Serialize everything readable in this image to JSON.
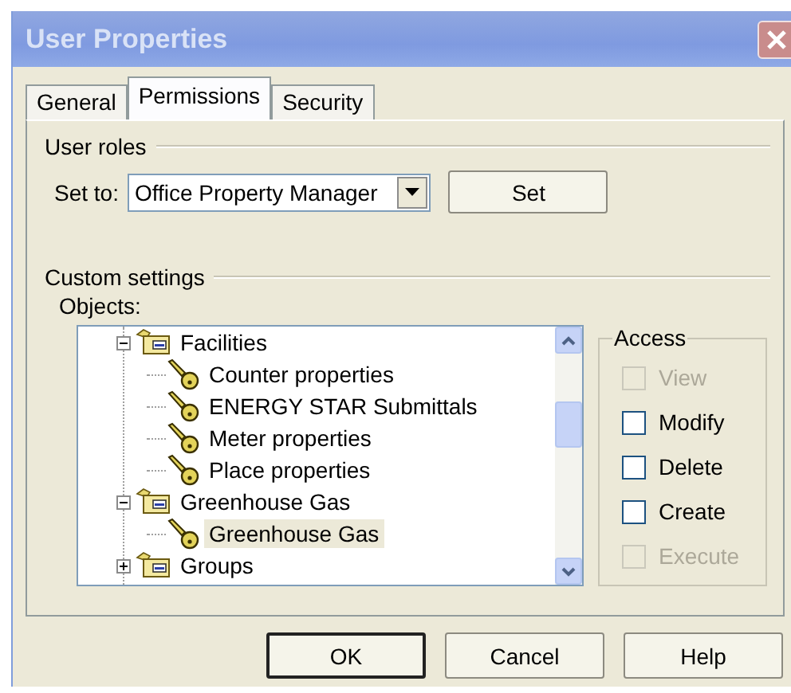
{
  "window": {
    "title": "User Properties"
  },
  "tabs": [
    {
      "label": "General",
      "selected": false
    },
    {
      "label": "Permissions",
      "selected": true
    },
    {
      "label": "Security",
      "selected": false
    }
  ],
  "user_roles": {
    "title": "User roles",
    "set_to_label": "Set to:",
    "role_value": "Office Property Manager",
    "set_button": "Set"
  },
  "custom_settings": {
    "title": "Custom settings",
    "objects_label": "Objects:",
    "tree": [
      {
        "label": "Facilities",
        "kind": "folder",
        "expanded": true,
        "selected": false,
        "children": [
          {
            "label": "Counter properties",
            "kind": "key",
            "selected": false
          },
          {
            "label": "ENERGY STAR Submittals",
            "kind": "key",
            "selected": false
          },
          {
            "label": "Meter properties",
            "kind": "key",
            "selected": false
          },
          {
            "label": "Place properties",
            "kind": "key",
            "selected": false
          }
        ]
      },
      {
        "label": "Greenhouse Gas",
        "kind": "folder",
        "expanded": true,
        "selected": false,
        "children": [
          {
            "label": "Greenhouse Gas",
            "kind": "key",
            "selected": true
          }
        ]
      },
      {
        "label": "Groups",
        "kind": "folder",
        "expanded": false,
        "selected": false
      }
    ],
    "access": {
      "title": "Access",
      "options": [
        {
          "label": "View",
          "checked": false,
          "disabled": true
        },
        {
          "label": "Modify",
          "checked": false,
          "disabled": false
        },
        {
          "label": "Delete",
          "checked": false,
          "disabled": false
        },
        {
          "label": "Create",
          "checked": false,
          "disabled": false
        },
        {
          "label": "Execute",
          "checked": false,
          "disabled": true
        }
      ]
    }
  },
  "buttons": [
    {
      "label": "OK",
      "default": true
    },
    {
      "label": "Cancel",
      "default": false
    },
    {
      "label": "Help",
      "default": false
    }
  ]
}
